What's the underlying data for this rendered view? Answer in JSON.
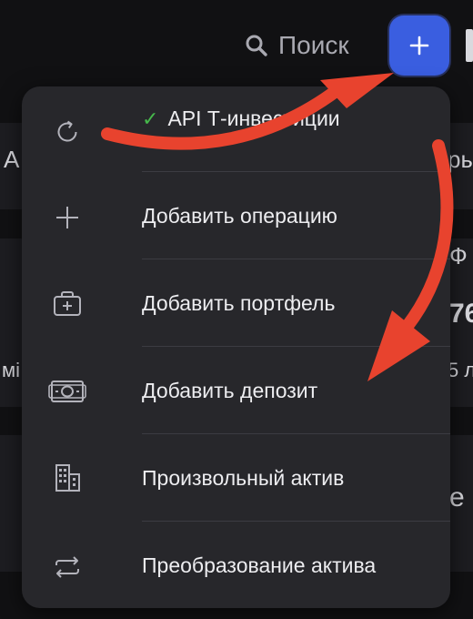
{
  "header": {
    "search_label": "Поиск",
    "add_button_symbol": "+",
    "accent_color": "#3a5ee0"
  },
  "background_fragments": {
    "left_a": "A",
    "right_ry": "ры",
    "right_f": "Ф",
    "right_num": "76",
    "left_m": "мі",
    "right_5": "5 л",
    "right_e": "е"
  },
  "menu": {
    "items": [
      {
        "label": "API Т-инвестиции",
        "icon": "refresh-icon",
        "checked": true
      },
      {
        "label": "Добавить операцию",
        "icon": "plus-icon"
      },
      {
        "label": "Добавить портфель",
        "icon": "briefcase-plus-icon"
      },
      {
        "label": "Добавить депозит",
        "icon": "banknote-icon"
      },
      {
        "label": "Произвольный актив",
        "icon": "building-icon"
      },
      {
        "label": "Преобразование актива",
        "icon": "swap-arrows-icon"
      }
    ],
    "check_color": "#46b84b"
  },
  "annotation": {
    "arrow_color": "#e8432e"
  }
}
